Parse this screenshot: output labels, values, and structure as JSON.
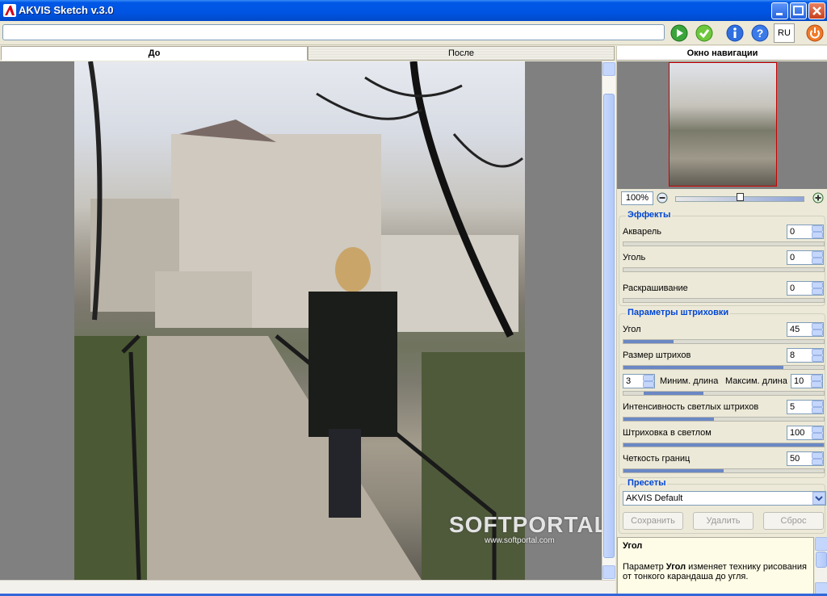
{
  "window": {
    "title": "AKVIS Sketch v.3.0"
  },
  "toolbar": {
    "language": "RU"
  },
  "tabs": [
    {
      "label": "До"
    },
    {
      "label": "После"
    }
  ],
  "watermark": {
    "brand": "SOFTPORTAL",
    "url": "www.softportal.com"
  },
  "navigator": {
    "title": "Окно навигации",
    "zoom": "100%",
    "zoom_level_fraction": 0.5
  },
  "effects": {
    "title": "Эффекты",
    "items": [
      {
        "label": "Акварель",
        "value": "0",
        "fraction": 0
      },
      {
        "label": "Уголь",
        "value": "0",
        "fraction": 0
      },
      {
        "label": "Раскрашивание",
        "value": "0",
        "fraction": 0
      }
    ]
  },
  "hatching": {
    "title": "Параметры штриховки",
    "angle": {
      "label": "Угол",
      "value": "45",
      "fraction": 0.25
    },
    "size": {
      "label": "Размер штрихов",
      "value": "8",
      "fraction": 0.8
    },
    "min_length": {
      "label": "Миним. длина",
      "value": "3"
    },
    "max_length": {
      "label": "Максим. длина",
      "value": "10"
    },
    "light_intensity": {
      "label": "Интенсивность светлых штрихов",
      "value": "5",
      "fraction": 0.45
    },
    "light_hatching": {
      "label": "Штриховка в светлом",
      "value": "100",
      "fraction": 1.0
    },
    "edge_clarity": {
      "label": "Четкость границ",
      "value": "50",
      "fraction": 0.5
    }
  },
  "presets": {
    "title": "Пресеты",
    "selected": "AKVIS Default",
    "save_label": "Сохранить",
    "delete_label": "Удалить",
    "reset_label": "Сброс"
  },
  "help": {
    "title": "Угол",
    "text_prefix": "Параметр ",
    "text_bold": "Угол",
    "text_suffix": " изменяет технику рисования от тонкого карандаша до угля."
  }
}
